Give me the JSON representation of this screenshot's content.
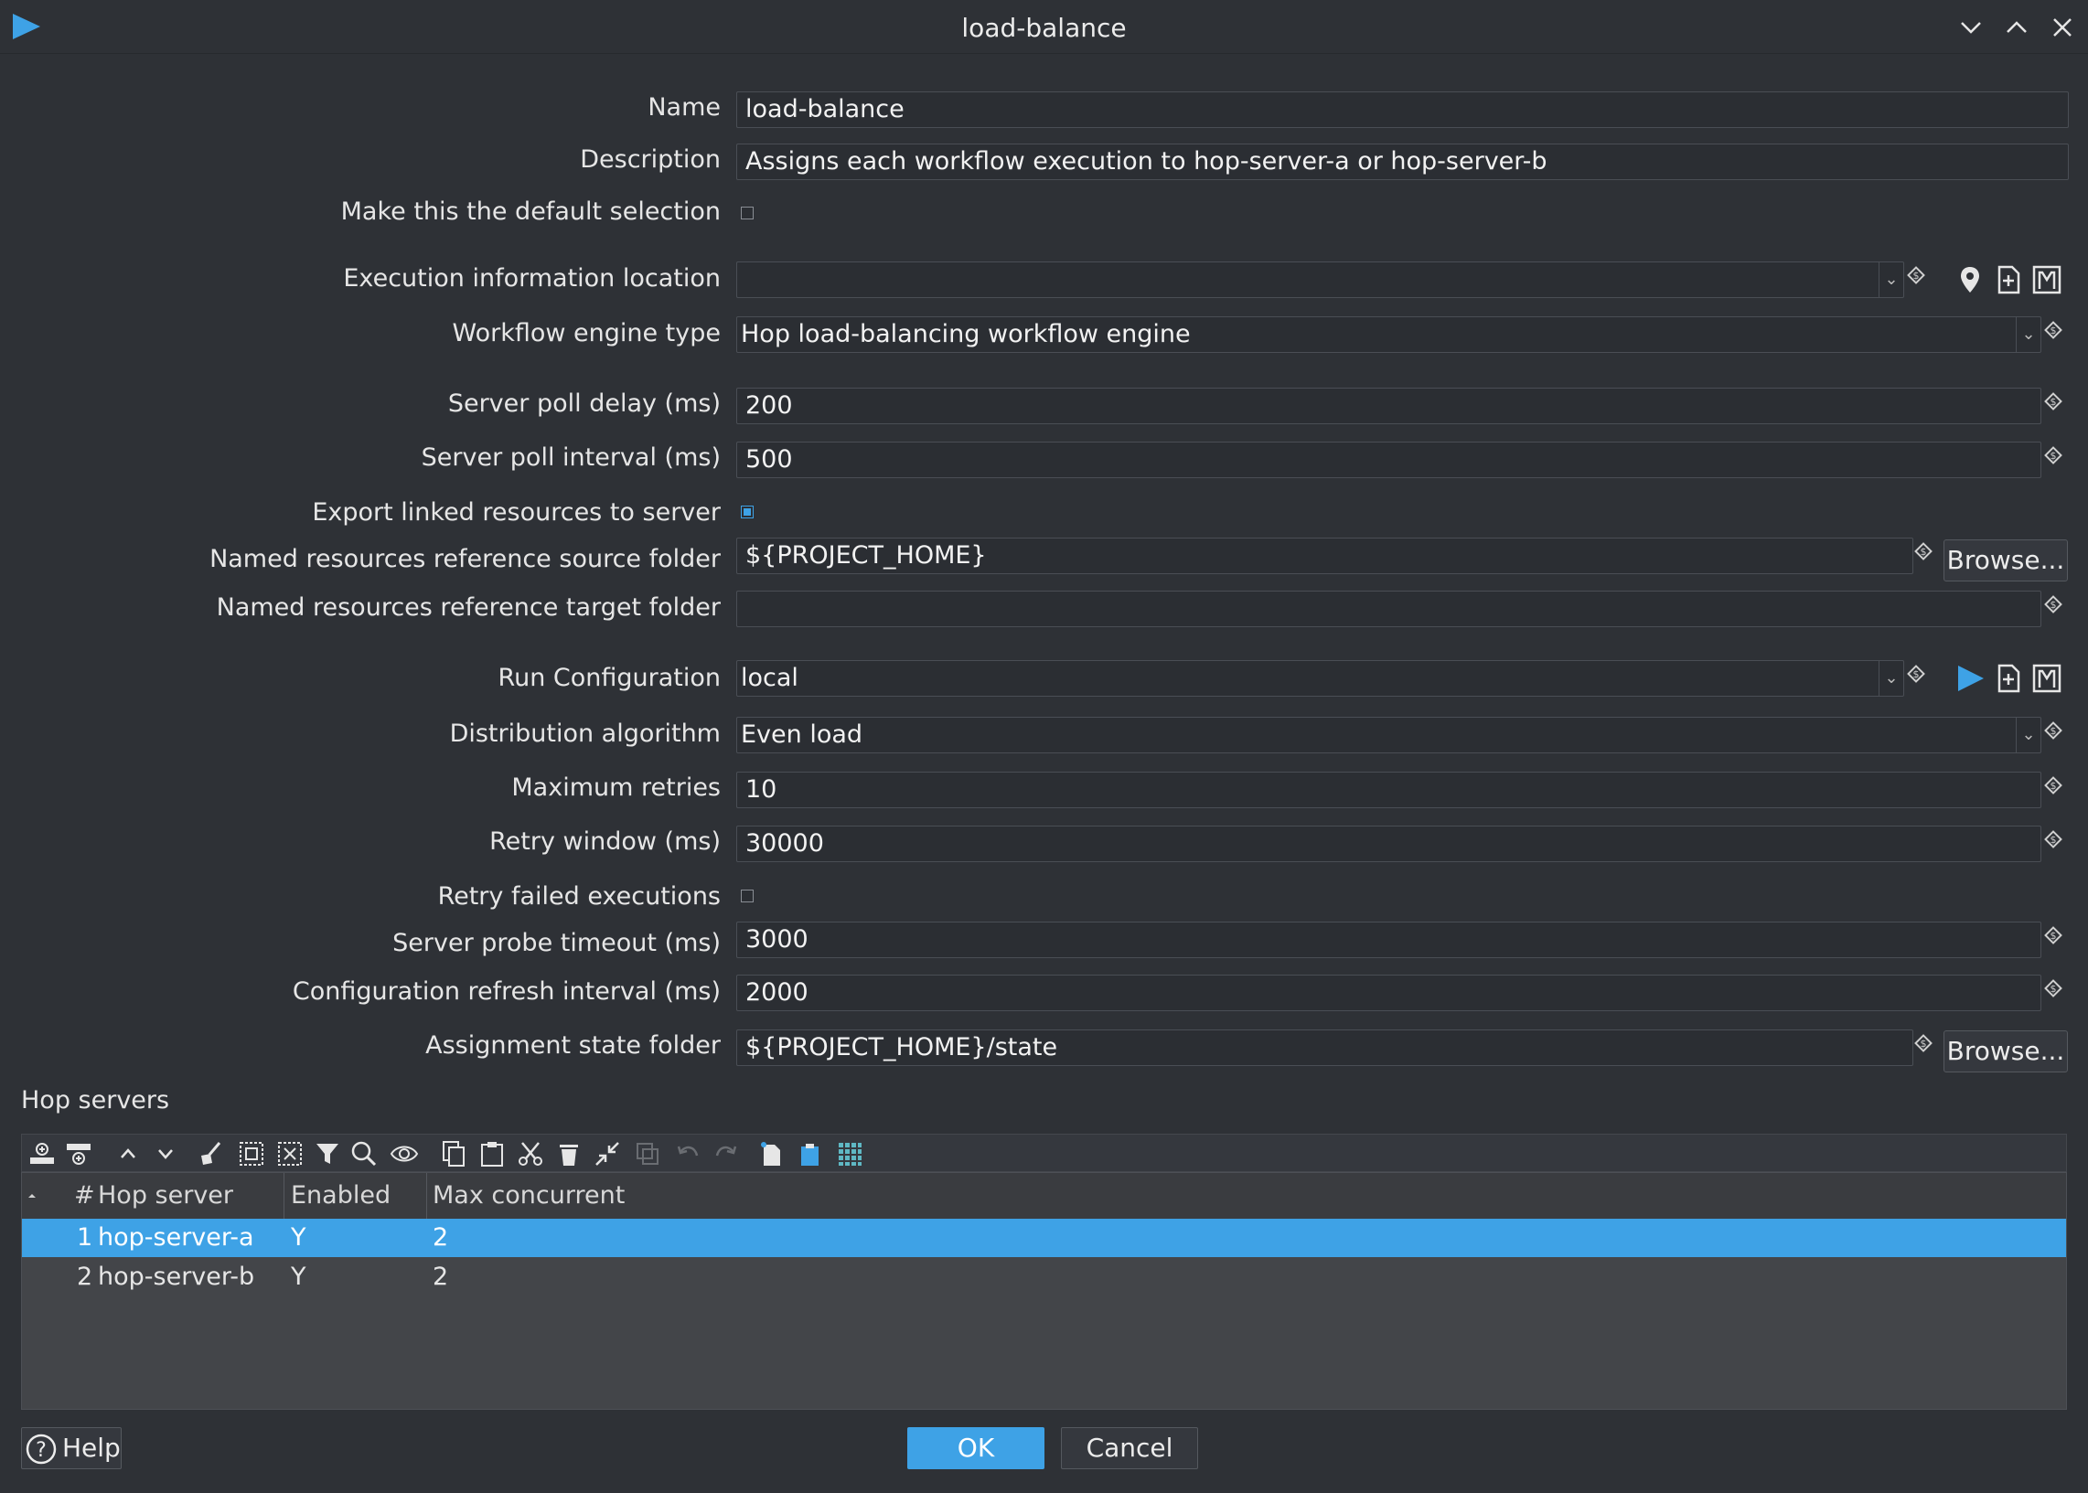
{
  "window": {
    "title": "load-balance"
  },
  "form": {
    "name_label": "Name",
    "name_value": "load-balance",
    "description_label": "Description",
    "description_value": "Assigns each workflow execution to hop-server-a or hop-server-b",
    "default_selection_label": "Make this the default selection",
    "default_selection_checked": false,
    "exec_info_location_label": "Execution information location",
    "exec_info_location_value": "",
    "workflow_engine_type_label": "Workflow engine type",
    "workflow_engine_type_value": "Hop load-balancing workflow engine",
    "server_poll_delay_label": "Server poll delay (ms)",
    "server_poll_delay_value": "200",
    "server_poll_interval_label": "Server poll interval (ms)",
    "server_poll_interval_value": "500",
    "export_linked_label": "Export linked resources to server",
    "export_linked_checked": true,
    "named_source_label": "Named resources reference source folder",
    "named_source_value": "${PROJECT_HOME}",
    "named_target_label": "Named resources reference target folder",
    "named_target_value": "",
    "run_config_label": "Run Configuration",
    "run_config_value": "local",
    "distribution_label": "Distribution algorithm",
    "distribution_value": "Even load",
    "max_retries_label": "Maximum retries",
    "max_retries_value": "10",
    "retry_window_label": "Retry window (ms)",
    "retry_window_value": "30000",
    "retry_failed_label": "Retry failed executions",
    "retry_failed_checked": false,
    "probe_timeout_label": "Server probe timeout (ms)",
    "probe_timeout_value": "3000",
    "config_refresh_label": "Configuration refresh interval (ms)",
    "config_refresh_value": "2000",
    "assignment_state_label": "Assignment state folder",
    "assignment_state_value": "${PROJECT_HOME}/state",
    "browse_label": "Browse..."
  },
  "hop_servers": {
    "title": "Hop servers",
    "columns": [
      "#",
      "Hop server",
      "Enabled",
      "Max concurrent"
    ],
    "rows": [
      {
        "num": "1",
        "server": "hop-server-a",
        "enabled": "Y",
        "max_concurrent": "2",
        "selected": true
      },
      {
        "num": "2",
        "server": "hop-server-b",
        "enabled": "Y",
        "max_concurrent": "2",
        "selected": false
      }
    ]
  },
  "buttons": {
    "help": "Help",
    "ok": "OK",
    "cancel": "Cancel"
  },
  "colors": {
    "accent": "#3ea2e6",
    "background": "#2e3136",
    "field_bg": "#2b2e33"
  }
}
